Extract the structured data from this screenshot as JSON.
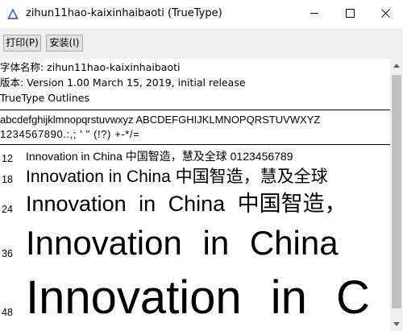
{
  "window": {
    "title": "zihun11hao-kaixinhaibaoti (TrueType)",
    "minimize_glyph": "—",
    "maximize_glyph": "☐",
    "close_glyph": "✕"
  },
  "toolbar": {
    "print_label": "打印(P)",
    "install_label": "安装(I)"
  },
  "info": {
    "font_name": "字体名称: zihun11hao-kaixinhaibaoti",
    "version": "版本: Version 1.00 March 15, 2019, initial release",
    "outline_type": "TrueType Outlines"
  },
  "sample": {
    "alphabet": "abcdefghijklmnopqrstuvwxyz  ABCDEFGHIJKLMNOPQRSTUVWXYZ",
    "digits": "1234567890.:,; ' \" (!?)  +-*/="
  },
  "previews": [
    {
      "size": "12",
      "text": "Innovation in China 中国智造，慧及全球 0123456789"
    },
    {
      "size": "18",
      "text": "Innovation in China 中国智造，慧及全球"
    },
    {
      "size": "24",
      "text": "Innovation in China 中国智造，"
    },
    {
      "size": "36",
      "text": "Innovation in China"
    },
    {
      "size": "48",
      "text": "Innovation in C"
    }
  ],
  "icons": {
    "app": "font-viewer-icon",
    "scroll_up": "arrow-up-icon",
    "scroll_down": "arrow-down-icon"
  },
  "colors": {
    "toolbar_bg": "#f0f0f0",
    "button_bg": "#e1e1e1",
    "scrollbar_thumb": "#c1c1c1"
  }
}
